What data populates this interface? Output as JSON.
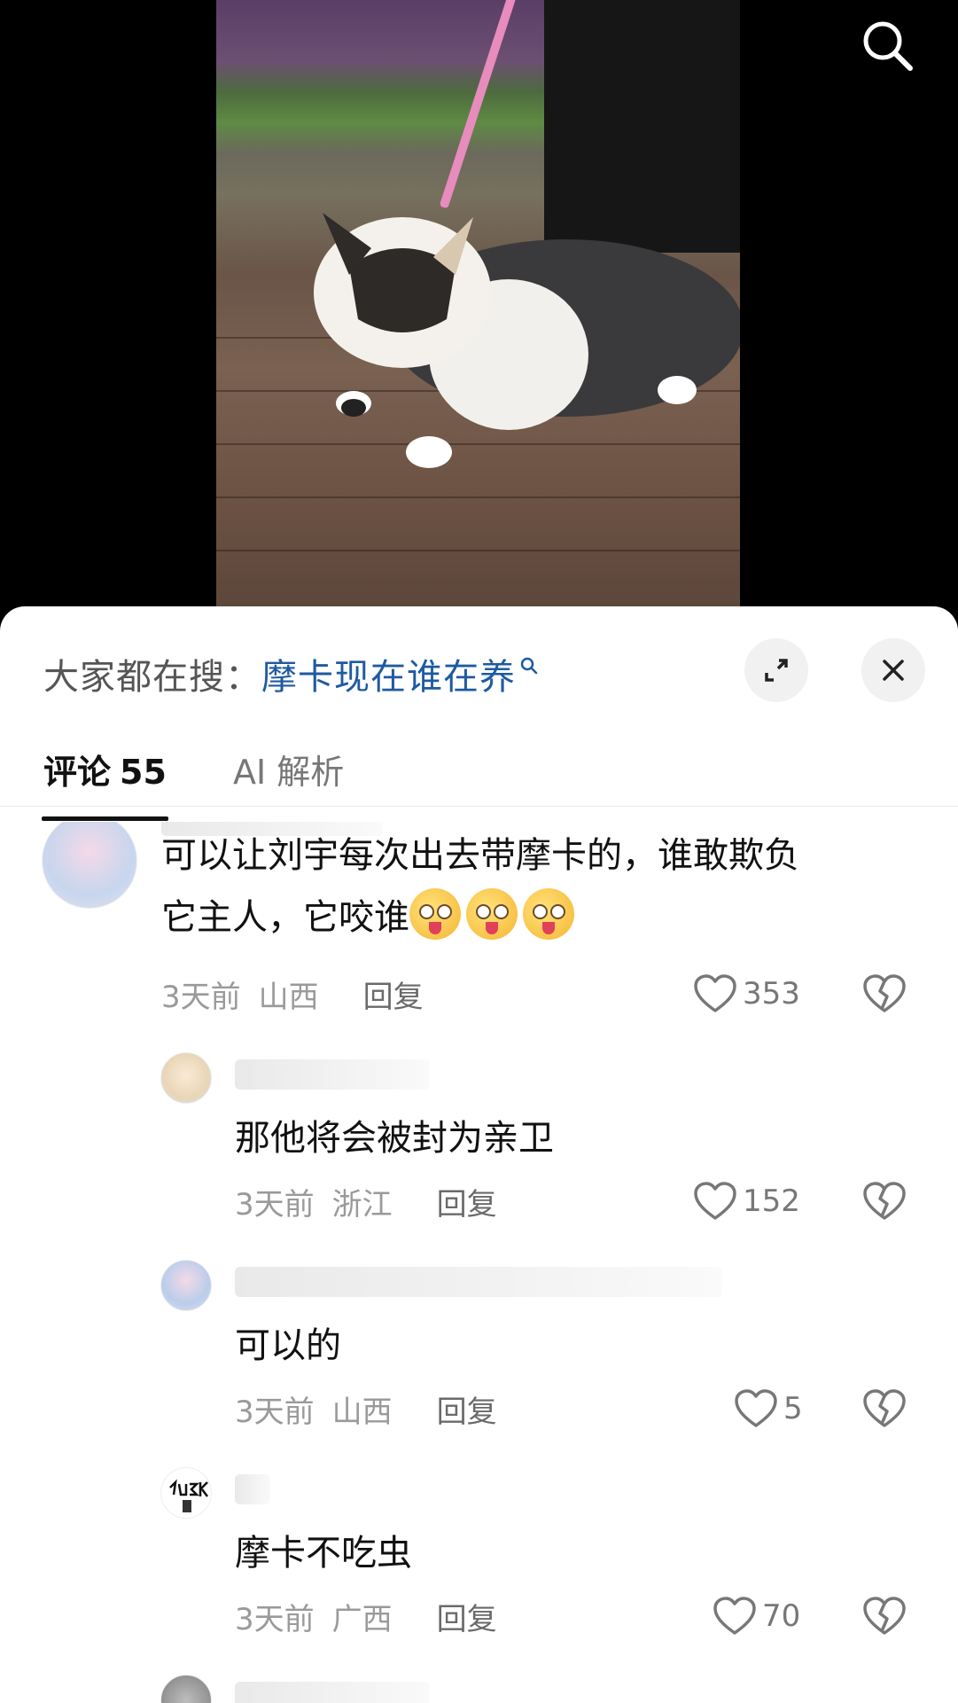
{
  "hot_search": {
    "label": "大家都在搜：",
    "term": "摩卡现在谁在养"
  },
  "tabs": {
    "comments_label": "评论",
    "comments_count": "55",
    "ai_label": "AI 解析"
  },
  "icons": {
    "search": "search-icon",
    "expand": "expand-icon",
    "close": "close-icon",
    "like": "heart-icon",
    "dislike": "broken-heart-icon",
    "emoji": "drooling-face-emoji"
  },
  "colors": {
    "accent_link": "#1e5aa0",
    "text": "#111111",
    "meta": "#9a9a9a"
  },
  "comments": [
    {
      "text_line1": "可以让刘宇每次出去带摩卡的，谁敢欺负",
      "text_line2": "它主人，它咬谁",
      "time": "3天前",
      "region": "山西",
      "reply_label": "回复",
      "likes": "353"
    },
    {
      "text": "那他将会被封为亲卫",
      "time": "3天前",
      "region": "浙江",
      "reply_label": "回复",
      "likes": "152"
    },
    {
      "text": "可以的",
      "time": "3天前",
      "region": "山西",
      "reply_label": "回复",
      "likes": "5"
    },
    {
      "text": "摩卡不吃虫",
      "time": "3天前",
      "region": "广西",
      "reply_label": "回复",
      "likes": "70"
    }
  ]
}
